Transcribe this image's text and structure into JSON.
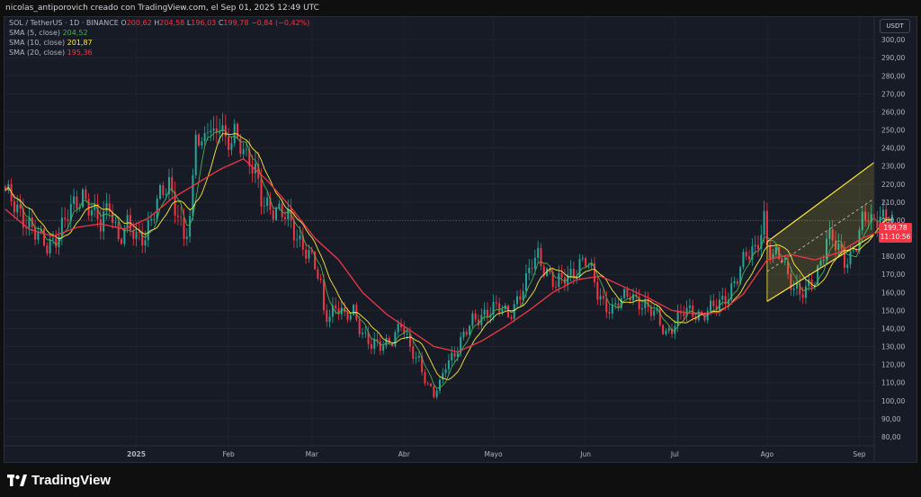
{
  "header": {
    "attribution": "nicolas_antiporovich creado con TradingView.com, el Sep 01, 2025 12:49 UTC"
  },
  "legend": {
    "symbol": "SOL / TetherUS · 1D · BINANCE",
    "open_label": "O",
    "open": "200,62",
    "high_label": "H",
    "high": "204,58",
    "low_label": "L",
    "low": "196,03",
    "close_label": "C",
    "close": "199,78",
    "change": "−0,84 (−0,42%)",
    "sma5_label": "SMA (5, close)",
    "sma5_value": "204,52",
    "sma10_label": "SMA (10, close)",
    "sma10_value": "201,87",
    "sma20_label": "SMA (20, close)",
    "sma20_value": "195,36"
  },
  "currency_button": "USDT",
  "last_price": {
    "value": "199,78",
    "countdown": "11:10:56"
  },
  "brand": {
    "name": "TradingView"
  },
  "colors": {
    "up": "#26a69a",
    "down": "#f23645",
    "sma5": "#4caf50",
    "sma10": "#ffeb3b",
    "sma20": "#f23645",
    "channel": "#ffeb3b"
  },
  "chart_data": {
    "type": "candlestick",
    "symbol": "SOL / TetherUS",
    "interval": "1D",
    "exchange": "BINANCE",
    "ylim": [
      75,
      312
    ],
    "y_ticks": [
      "80,00",
      "90,00",
      "100,00",
      "110,00",
      "120,00",
      "130,00",
      "140,00",
      "150,00",
      "160,00",
      "170,00",
      "180,00",
      "190,00",
      "200,00",
      "210,00",
      "220,00",
      "230,00",
      "240,00",
      "250,00",
      "260,00",
      "270,00",
      "280,00",
      "290,00",
      "300,00"
    ],
    "x_labels": [
      "2025",
      "Feb",
      "Mar",
      "Abr",
      "Mayo",
      "Jun",
      "Jul",
      "Ago",
      "Sep"
    ],
    "x_label_days": [
      44,
      75,
      103,
      134,
      164,
      195,
      225,
      256,
      287
    ],
    "x_range_days": [
      0,
      292
    ],
    "series": [
      {
        "name": "SMA (5, close)",
        "last": 204.52
      },
      {
        "name": "SMA (10, close)",
        "last": 201.87
      },
      {
        "name": "SMA (20, close)",
        "last": 195.36
      }
    ],
    "close_path": [
      [
        0,
        214
      ],
      [
        5,
        205
      ],
      [
        10,
        192
      ],
      [
        14,
        186
      ],
      [
        18,
        193
      ],
      [
        22,
        205
      ],
      [
        26,
        215
      ],
      [
        29,
        206
      ],
      [
        32,
        196
      ],
      [
        35,
        210
      ],
      [
        38,
        190
      ],
      [
        41,
        196
      ],
      [
        44,
        190
      ],
      [
        47,
        193
      ],
      [
        50,
        205
      ],
      [
        52,
        212
      ],
      [
        55,
        220
      ],
      [
        58,
        205
      ],
      [
        60,
        190
      ],
      [
        62,
        198
      ],
      [
        63,
        218
      ],
      [
        64,
        250
      ],
      [
        66,
        240
      ],
      [
        68,
        258
      ],
      [
        70,
        245
      ],
      [
        72,
        252
      ],
      [
        74,
        240
      ],
      [
        77,
        250
      ],
      [
        79,
        245
      ],
      [
        81,
        233
      ],
      [
        84,
        225
      ],
      [
        86,
        213
      ],
      [
        89,
        208
      ],
      [
        92,
        203
      ],
      [
        95,
        201
      ],
      [
        98,
        192
      ],
      [
        101,
        183
      ],
      [
        104,
        174
      ],
      [
        106,
        163
      ],
      [
        107,
        150
      ],
      [
        109,
        148
      ],
      [
        111,
        153
      ],
      [
        114,
        145
      ],
      [
        117,
        150
      ],
      [
        120,
        138
      ],
      [
        123,
        130
      ],
      [
        126,
        130
      ],
      [
        130,
        135
      ],
      [
        133,
        142
      ],
      [
        136,
        128
      ],
      [
        139,
        123
      ],
      [
        142,
        108
      ],
      [
        144,
        103
      ],
      [
        146,
        108
      ],
      [
        148,
        121
      ],
      [
        151,
        127
      ],
      [
        154,
        135
      ],
      [
        157,
        144
      ],
      [
        160,
        148
      ],
      [
        163,
        150
      ],
      [
        166,
        151
      ],
      [
        169,
        148
      ],
      [
        172,
        156
      ],
      [
        175,
        165
      ],
      [
        177,
        176
      ],
      [
        179,
        181
      ],
      [
        182,
        172
      ],
      [
        185,
        163
      ],
      [
        188,
        168
      ],
      [
        191,
        172
      ],
      [
        193,
        176
      ],
      [
        195,
        177
      ],
      [
        197,
        170
      ],
      [
        199,
        160
      ],
      [
        201,
        155
      ],
      [
        204,
        150
      ],
      [
        207,
        155
      ],
      [
        210,
        160
      ],
      [
        213,
        155
      ],
      [
        216,
        150
      ],
      [
        219,
        147
      ],
      [
        222,
        138
      ],
      [
        225,
        142
      ],
      [
        228,
        149
      ],
      [
        231,
        150
      ],
      [
        234,
        147
      ],
      [
        237,
        150
      ],
      [
        240,
        154
      ],
      [
        243,
        160
      ],
      [
        246,
        168
      ],
      [
        249,
        180
      ],
      [
        252,
        185
      ],
      [
        255,
        201
      ],
      [
        256,
        185
      ],
      [
        258,
        178
      ],
      [
        261,
        181
      ],
      [
        263,
        170
      ],
      [
        265,
        164
      ],
      [
        267,
        158
      ],
      [
        269,
        160
      ],
      [
        272,
        168
      ],
      [
        274,
        178
      ],
      [
        276,
        190
      ],
      [
        278,
        188
      ],
      [
        280,
        183
      ],
      [
        282,
        178
      ],
      [
        284,
        181
      ],
      [
        286,
        188
      ],
      [
        288,
        198
      ],
      [
        290,
        201
      ],
      [
        292,
        197
      ],
      [
        294,
        206
      ],
      [
        296,
        200
      ],
      [
        298,
        199.78
      ]
    ],
    "sma20_points": [
      [
        0,
        206
      ],
      [
        8,
        195
      ],
      [
        16,
        191
      ],
      [
        24,
        196
      ],
      [
        32,
        198
      ],
      [
        40,
        195
      ],
      [
        48,
        201
      ],
      [
        56,
        212
      ],
      [
        64,
        220
      ],
      [
        72,
        228
      ],
      [
        80,
        234
      ],
      [
        88,
        222
      ],
      [
        96,
        207
      ],
      [
        104,
        190
      ],
      [
        112,
        178
      ],
      [
        120,
        160
      ],
      [
        128,
        148
      ],
      [
        136,
        139
      ],
      [
        144,
        130
      ],
      [
        152,
        127
      ],
      [
        160,
        133
      ],
      [
        168,
        141
      ],
      [
        176,
        150
      ],
      [
        184,
        160
      ],
      [
        192,
        167
      ],
      [
        200,
        169
      ],
      [
        208,
        163
      ],
      [
        216,
        157
      ],
      [
        224,
        150
      ],
      [
        232,
        148
      ],
      [
        240,
        149
      ],
      [
        248,
        159
      ],
      [
        256,
        178
      ],
      [
        264,
        181
      ],
      [
        272,
        178
      ],
      [
        280,
        182
      ],
      [
        288,
        190
      ],
      [
        296,
        195
      ],
      [
        298,
        195.36
      ]
    ],
    "channel": {
      "upper": [
        [
          256,
          188
        ],
        [
          292,
          232
        ]
      ],
      "lower": [
        [
          256,
          155
        ],
        [
          292,
          192
        ]
      ]
    },
    "reference_price": 199.78
  }
}
